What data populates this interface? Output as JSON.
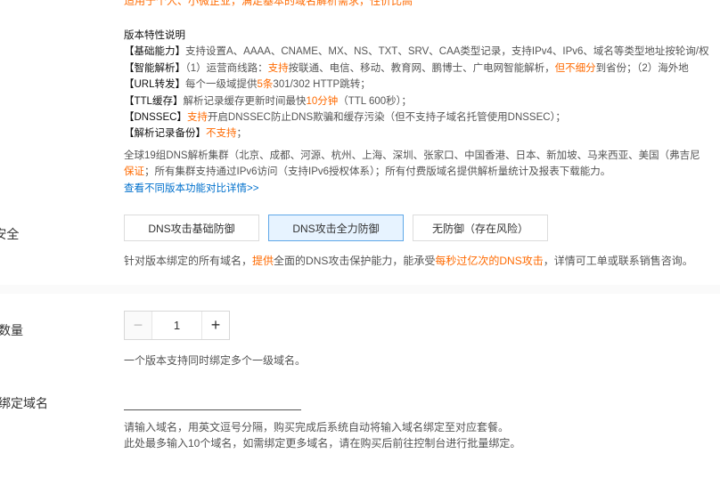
{
  "intro": "适用于个人、小微企业，满足基本的域名解析需求，性价比高",
  "features": {
    "title": "版本特性说明",
    "basic": {
      "label": "【基础能力】",
      "text": "支持设置A、AAAA、CNAME、MX、NS、TXT、SRV、CAA类型记录，支持IPv4、IPv6、域名等类型地址按轮询/权"
    },
    "smart": {
      "label": "【智能解析】",
      "p1": "（1）运营商线路：",
      "hl1": "支持",
      "p2": "按联通、电信、移动、教育网、鹏博士、广电网智能解析，",
      "hl2": "但不细分",
      "p3": "到省份；（2）海外地"
    },
    "url": {
      "label": "【URL转发】",
      "p1": "每个一级域提供",
      "hl": "5条",
      "p2": "301/302 HTTP跳转；"
    },
    "ttl": {
      "label": "【TTL缓存】",
      "p1": "解析记录缓存更新时间最快",
      "hl": "10分钟",
      "p2": "（TTL 600秒）；"
    },
    "dnssec": {
      "label": "【DNSSEC】",
      "hl": "支持",
      "p2": "开启DNSSEC防止DNS欺骗和缓存污染（但不支持子域名托管使用DNSSEC）；"
    },
    "backup": {
      "label": "【解析记录备份】",
      "hl": "不支持",
      "p2": "；"
    },
    "cluster1": "全球19组DNS解析集群（北京、成都、河源、杭州、上海、深圳、张家口、中国香港、日本、新加坡、马来西亚、美国（弗吉尼",
    "cluster2_hl": "保证",
    "cluster2": "；所有集群支持通过IPv6访问（支持IPv6授权体系）；所有付费版域名提供解析量统计及报表下载能力。",
    "compare_link": "查看不同版本功能对比详情>>"
  },
  "security": {
    "label": "S安全",
    "options": [
      "DNS攻击基础防御",
      "DNS攻击全力防御",
      "无防御（存在风险）"
    ],
    "selected": 1,
    "note_p1": "针对版本绑定的所有域名，",
    "note_hl1": "提供",
    "note_p2": "全面的DNS攻击保护能力，能承受",
    "note_hl2": "每秒过亿次的DNS攻击",
    "note_p3": "，详情可工单或联系销售咨询。"
  },
  "quantity": {
    "label": "名数量",
    "value": "1",
    "minus": "−",
    "plus": "+",
    "note": "一个版本支持同时绑定多个一级域名。"
  },
  "bind": {
    "label": "次绑定域名",
    "input_value": "",
    "note1": "请输入域名，用英文逗号分隔，购买完成后系统自动将输入域名绑定至对应套餐。",
    "note2": "此处最多输入10个域名，如需绑定更多域名，请在购买后前往控制台进行批量绑定。"
  },
  "colors": {
    "accent": "#ff6a00",
    "link": "#0070cc",
    "selected_bg": "#e7f3ff"
  }
}
